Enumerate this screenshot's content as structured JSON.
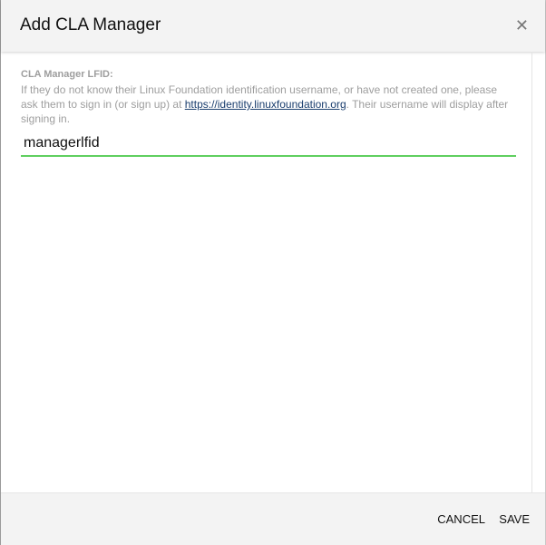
{
  "dialog": {
    "title": "Add CLA Manager",
    "close_icon": "close-icon"
  },
  "form": {
    "label": "CLA Manager LFID:",
    "help_before": "If they do not know their Linux Foundation identification username, or have not created one, please ask them to sign in (or sign up) at ",
    "help_link": "https://identity.linuxfoundation.org",
    "help_after": ". Their username will display after signing in.",
    "input_value": "managerlfid",
    "accent_color": "#5fcf5f"
  },
  "footer": {
    "cancel_label": "CANCEL",
    "save_label": "SAVE"
  }
}
